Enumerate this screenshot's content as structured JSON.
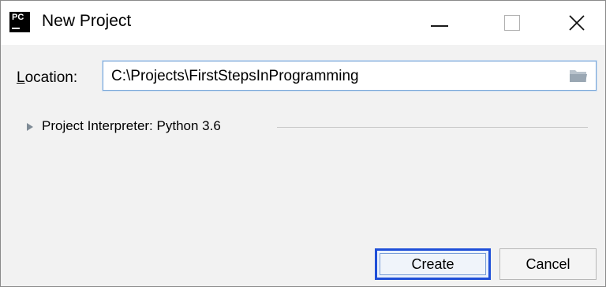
{
  "window": {
    "title": "New Project",
    "app_icon_text": "PC"
  },
  "location": {
    "label_accel": "L",
    "label_rest": "ocation:",
    "value": "C:\\Projects\\FirstStepsInProgramming"
  },
  "interpreter": {
    "label": "Project Interpreter: Python 3.6"
  },
  "buttons": {
    "create": "Create",
    "cancel": "Cancel"
  },
  "colors": {
    "focus_border": "#1f4fd8",
    "input_border": "#7aa7d8"
  }
}
